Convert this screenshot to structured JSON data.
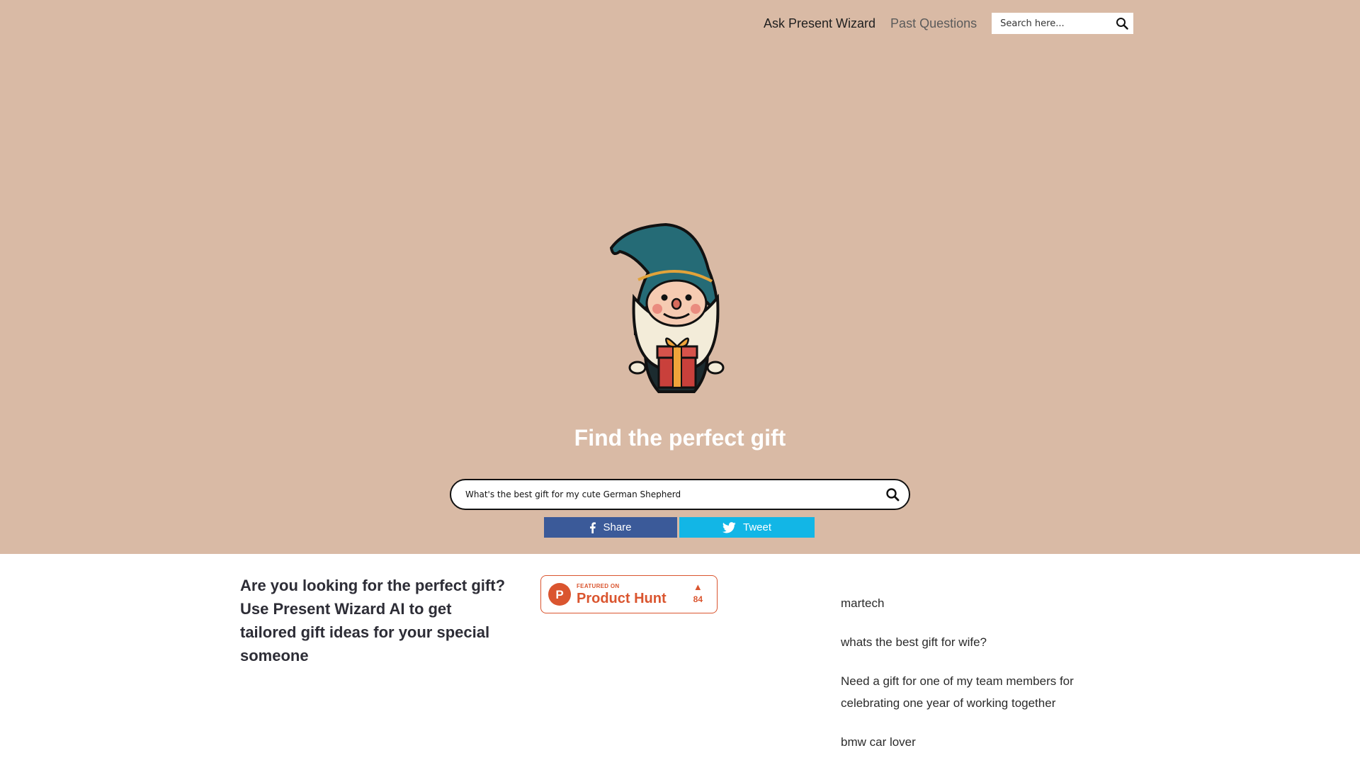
{
  "nav": {
    "ask_label": "Ask Present Wizard",
    "past_label": "Past Questions",
    "search_placeholder": "Search here..."
  },
  "hero": {
    "headline": "Find the perfect gift",
    "search_value": "What's the best gift for my cute German Shepherd",
    "share_label": "Share",
    "tweet_label": "Tweet",
    "background_color": "#d9baa5"
  },
  "pitch": {
    "text": "Are you looking for the perfect gift? Use Present Wizard AI to get tailored gift ideas for your special someone"
  },
  "product_hunt": {
    "featured": "FEATURED ON",
    "name": "Product Hunt",
    "votes": "84",
    "logo_letter": "P",
    "color": "#da552f"
  },
  "past_questions": [
    "martech",
    "whats the best gift for wife?",
    "Need a gift for one of my team members for celebrating one year of working together",
    "bmw car lover"
  ],
  "icons": {
    "search": "search-icon",
    "facebook": "facebook-icon",
    "twitter": "twitter-icon",
    "wizard": "wizard-mascot"
  }
}
